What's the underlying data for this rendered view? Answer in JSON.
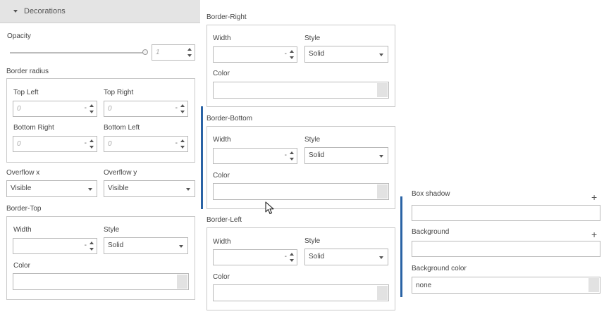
{
  "decorations": {
    "header_label": "Decorations",
    "opacity": {
      "label": "Opacity",
      "value_placeholder": "1",
      "slider_fraction": 1.0
    },
    "border_radius": {
      "label": "Border radius",
      "top_left": {
        "label": "Top Left",
        "placeholder": "0"
      },
      "top_right": {
        "label": "Top Right",
        "placeholder": "0"
      },
      "bottom_right": {
        "label": "Bottom Right",
        "placeholder": "0"
      },
      "bottom_left": {
        "label": "Bottom Left",
        "placeholder": "0"
      },
      "unit_dash": "-"
    },
    "overflow_x": {
      "label": "Overflow x",
      "value": "Visible"
    },
    "overflow_y": {
      "label": "Overflow y",
      "value": "Visible"
    },
    "border_top": {
      "label": "Border-Top",
      "width_label": "Width",
      "width_dash": "-",
      "style_label": "Style",
      "style_value": "Solid",
      "color_label": "Color"
    }
  },
  "border_right": {
    "label": "Border-Right",
    "width_label": "Width",
    "width_dash": "-",
    "style_label": "Style",
    "style_value": "Solid",
    "color_label": "Color"
  },
  "border_bottom": {
    "label": "Border-Bottom",
    "width_label": "Width",
    "width_dash": "-",
    "style_label": "Style",
    "style_value": "Solid",
    "color_label": "Color"
  },
  "border_left": {
    "label": "Border-Left",
    "width_label": "Width",
    "width_dash": "-",
    "style_label": "Style",
    "style_value": "Solid",
    "color_label": "Color"
  },
  "effects": {
    "box_shadow_label": "Box shadow",
    "background_label": "Background",
    "background_color_label": "Background color",
    "background_color_value": "none",
    "plus_symbol": "+"
  },
  "colors": {
    "accent": "#2a63a5",
    "header_bg": "#e4e4e4",
    "swatch": "#e2e2e2"
  }
}
